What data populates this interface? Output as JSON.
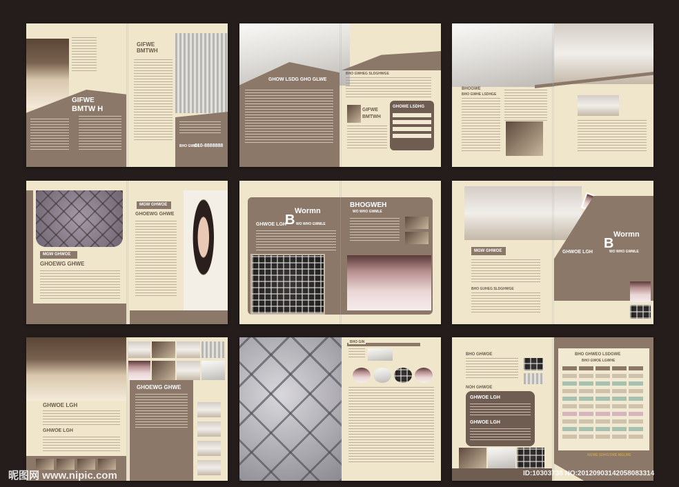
{
  "watermark": {
    "left": "昵图网 www.nipic.com",
    "right": "ID:10303738 NO:20120903142058083314"
  },
  "s1": {
    "title1": "GIFWE",
    "title2": "BMTWH",
    "big1": "GIFWE",
    "big2": "BMTW  H",
    "phone_label": "BHO  GWEH",
    "phone": "010-8888888"
  },
  "s2": {
    "heading": "GHOW LSDG GHO GLWE",
    "sub": "BHO GWHEG SLDGHWGE",
    "name1": "GIFWE",
    "name2": "BMTWH",
    "box_title": "GHOWE LSDHG"
  },
  "s3": {
    "h1": "BHOGWE",
    "h2": "BHO GWHE LSDHGE"
  },
  "s4": {
    "tag1": "MGW GHWOE",
    "tag1b": "GHOEWG GHWE",
    "tag2": "MGW GHWOE",
    "tag2b": "GHOEWG GHWE"
  },
  "s5": {
    "brand": "BHOGWEH",
    "brand_sub": "WO WHO GWMLE",
    "line": "GHWOE LGH",
    "B": "B",
    "W": "Wormn",
    "sub": "WO WHO GWMLE"
  },
  "s6": {
    "line": "GHWOE LGH",
    "B": "B",
    "W": "Wormn",
    "sub": "WO WHO GWMLE",
    "tag": "MGW GHWOE",
    "sub2": "BHO GUHEG SLDGHWGE"
  },
  "s7": {
    "h1": "GHOEWG GHWE",
    "h2": "GHWOE LGH",
    "h3": "GHWOE LGH"
  },
  "s8": {
    "label": "BHO GIN"
  },
  "s9": {
    "h1": "BHO GHWOE",
    "h2": "NOH GHWOE",
    "b1": "GHWOE LGH",
    "b2": "GHWOE LGH",
    "t1": "BHO GHWEO LSDGWE",
    "t2": "BHO GWOE LGWHE",
    "foot": "NGWE SDHGOWE MGLWE"
  }
}
